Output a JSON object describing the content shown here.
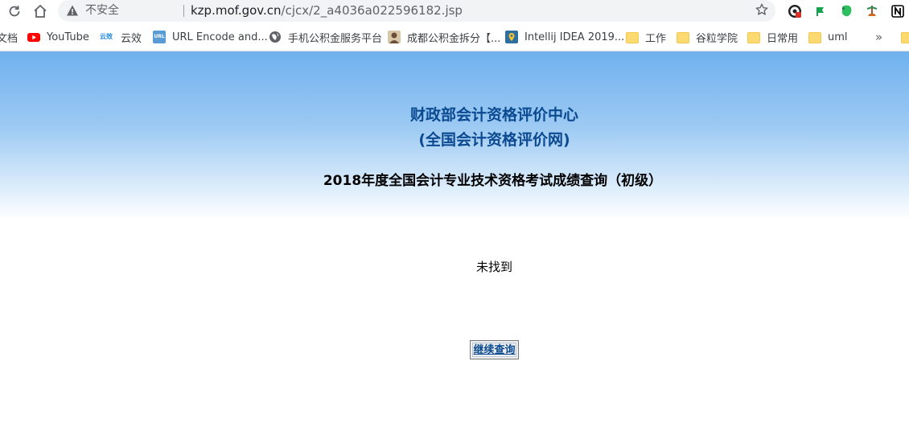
{
  "browser": {
    "insecure_label": "不安全",
    "url_host": "kzp.mof.gov.cn",
    "url_path": "/cjcx/2_a4036a022596182.jsp",
    "icons": {
      "reload": "reload-icon",
      "home": "home-icon",
      "warning": "warning-icon",
      "star": "star-icon"
    },
    "extensions": [
      "extension-at-icon",
      "extension-flag-icon",
      "evernote-icon",
      "extension-game-icon",
      "notion-icon"
    ]
  },
  "bookmarks": {
    "items": [
      {
        "label": "文档",
        "icon": "doc-icon"
      },
      {
        "label": "YouTube",
        "icon": "youtube-icon"
      },
      {
        "label": "云效",
        "icon": "yunxiao-icon",
        "icon_text": "云效"
      },
      {
        "label": "URL Encode and...",
        "icon": "url-icon",
        "icon_text": "URL"
      },
      {
        "label": "手机公积金服务平台",
        "icon": "globe-icon"
      },
      {
        "label": "成都公积金拆分【...",
        "icon": "avatar-icon"
      },
      {
        "label": "Intellij IDEA 2019...",
        "icon": "map-pin-icon"
      },
      {
        "label": "工作",
        "icon": "folder-icon"
      },
      {
        "label": "谷粒学院",
        "icon": "folder-icon"
      },
      {
        "label": "日常用",
        "icon": "folder-icon"
      },
      {
        "label": "uml",
        "icon": "folder-icon"
      }
    ],
    "overflow_label": "»"
  },
  "page": {
    "org_title_line1": "财政部会计资格评价中心",
    "org_title_line2": "(全国会计资格评价网)",
    "exam_title": "2018年度全国会计专业技术资格考试成绩查询（初级）",
    "result_message": "未找到",
    "continue_button": "继续查询"
  },
  "colors": {
    "header_gradient_top": "#6fb1ee",
    "header_gradient_bottom": "#ffffff",
    "org_title": "#0b4a90",
    "link": "#0b4a90"
  }
}
